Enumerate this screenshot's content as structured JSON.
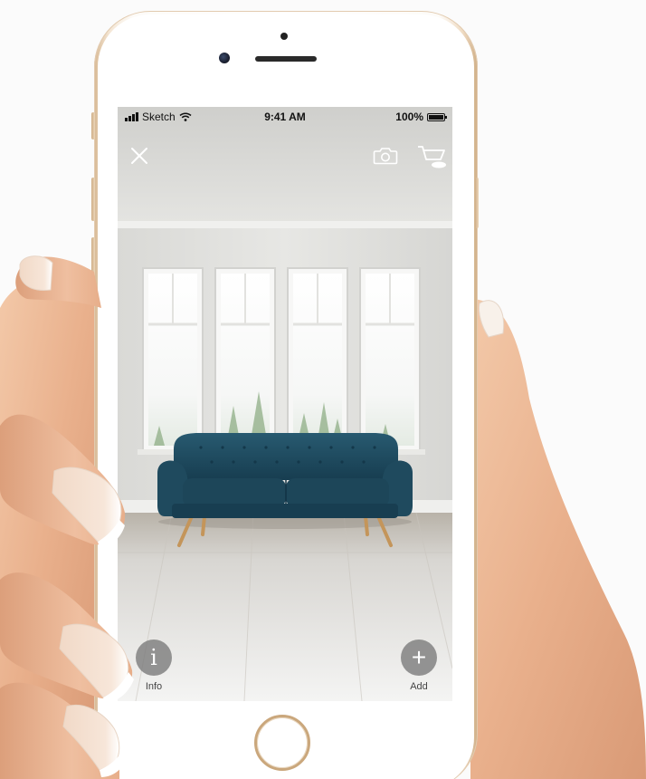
{
  "status_bar": {
    "carrier": "Sketch",
    "time": "9:41 AM",
    "battery": "100%"
  },
  "toolbar": {
    "close_icon": "close-icon",
    "camera_icon": "camera-icon",
    "cart_icon": "cart-icon"
  },
  "actions": {
    "info_label": "Info",
    "info_glyph": "i",
    "add_label": "Add",
    "add_glyph": "+"
  },
  "colors": {
    "sofa": "#1f4a5e",
    "phone_gold": "#caa77c",
    "fab_bg": "#7a7a7a"
  }
}
